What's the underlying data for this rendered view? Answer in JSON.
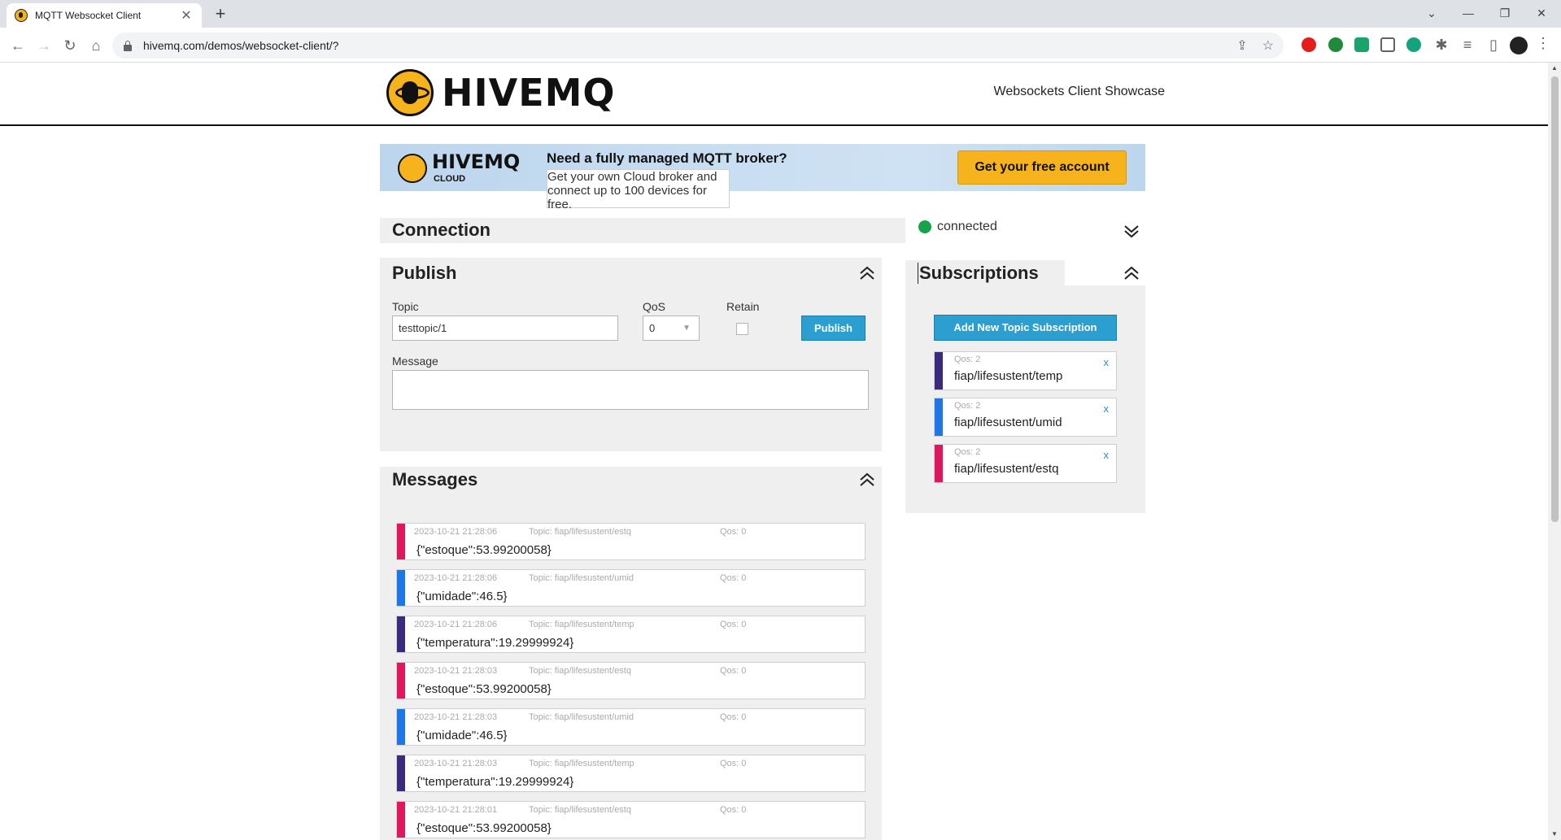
{
  "browser": {
    "tab_title": "MQTT Websocket Client",
    "tab_close": "✕",
    "new_tab": "+",
    "url": "hivemq.com/demos/websocket-client/?",
    "window_controls": [
      "⌄",
      "—",
      "❐",
      "✕"
    ]
  },
  "site": {
    "logo_text": "HIVEMQ",
    "header_right": "Websockets Client Showcase"
  },
  "banner": {
    "logo_text": "HIVEMQ",
    "logo_sub": "CLOUD",
    "headline": "Need a fully managed MQTT broker?",
    "subline": "Get your own Cloud broker and connect up to 100 devices for free.",
    "cta": "Get your free account"
  },
  "connection": {
    "title": "Connection",
    "status": "connected",
    "status_color": "#17a34a"
  },
  "publish": {
    "title": "Publish",
    "topic_label": "Topic",
    "topic_value": "testtopic/1",
    "qos_label": "QoS",
    "qos_value": "0",
    "retain_label": "Retain",
    "publish_button": "Publish",
    "message_label": "Message",
    "message_value": ""
  },
  "messages": {
    "title": "Messages",
    "items": [
      {
        "time": "2023-10-21 21:28:06",
        "topic": "Topic: fiap/lifesustent/estq",
        "qos": "Qos: 0",
        "payload": "{\"estoque\":53.99200058}",
        "color": "#e2165e"
      },
      {
        "time": "2023-10-21 21:28:06",
        "topic": "Topic: fiap/lifesustent/umid",
        "qos": "Qos: 0",
        "payload": "{\"umidade\":46.5}",
        "color": "#1e77e8"
      },
      {
        "time": "2023-10-21 21:28:06",
        "topic": "Topic: fiap/lifesustent/temp",
        "qos": "Qos: 0",
        "payload": "{\"temperatura\":19.29999924}",
        "color": "#3b2a7e"
      },
      {
        "time": "2023-10-21 21:28:03",
        "topic": "Topic: fiap/lifesustent/estq",
        "qos": "Qos: 0",
        "payload": "{\"estoque\":53.99200058}",
        "color": "#e2165e"
      },
      {
        "time": "2023-10-21 21:28:03",
        "topic": "Topic: fiap/lifesustent/umid",
        "qos": "Qos: 0",
        "payload": "{\"umidade\":46.5}",
        "color": "#1e77e8"
      },
      {
        "time": "2023-10-21 21:28:03",
        "topic": "Topic: fiap/lifesustent/temp",
        "qos": "Qos: 0",
        "payload": "{\"temperatura\":19.29999924}",
        "color": "#3b2a7e"
      },
      {
        "time": "2023-10-21 21:28:01",
        "topic": "Topic: fiap/lifesustent/estq",
        "qos": "Qos: 0",
        "payload": "{\"estoque\":53.99200058}",
        "color": "#e2165e"
      }
    ]
  },
  "subscriptions": {
    "title": "Subscriptions",
    "add_button": "Add New Topic Subscription",
    "items": [
      {
        "qos": "Qos: 2",
        "topic": "fiap/lifesustent/temp",
        "color": "#3b2a7e",
        "remove": "x"
      },
      {
        "qos": "Qos: 2",
        "topic": "fiap/lifesustent/umid",
        "color": "#1e77e8",
        "remove": "x"
      },
      {
        "qos": "Qos: 2",
        "topic": "fiap/lifesustent/estq",
        "color": "#e2165e",
        "remove": "x"
      }
    ]
  }
}
